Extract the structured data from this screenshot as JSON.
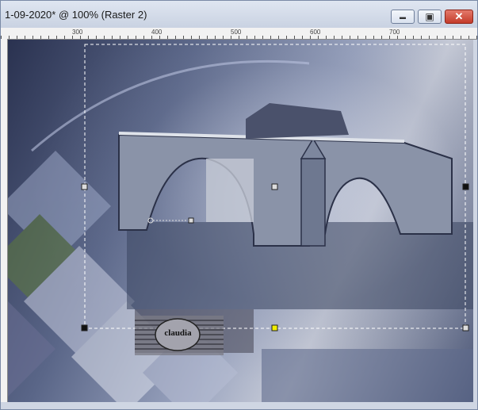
{
  "window": {
    "title": "1-09-2020* @ 100% (Raster 2)",
    "buttons": {
      "minimize": "▬",
      "maximize": "▣",
      "close": "✕"
    }
  },
  "ruler": {
    "labels": [
      "300",
      "400",
      "500",
      "600",
      "700"
    ]
  },
  "canvas": {
    "watermark": "claudia"
  },
  "colors": {
    "accent": "#c43b2a",
    "selection_handle": "#f2ef00"
  }
}
